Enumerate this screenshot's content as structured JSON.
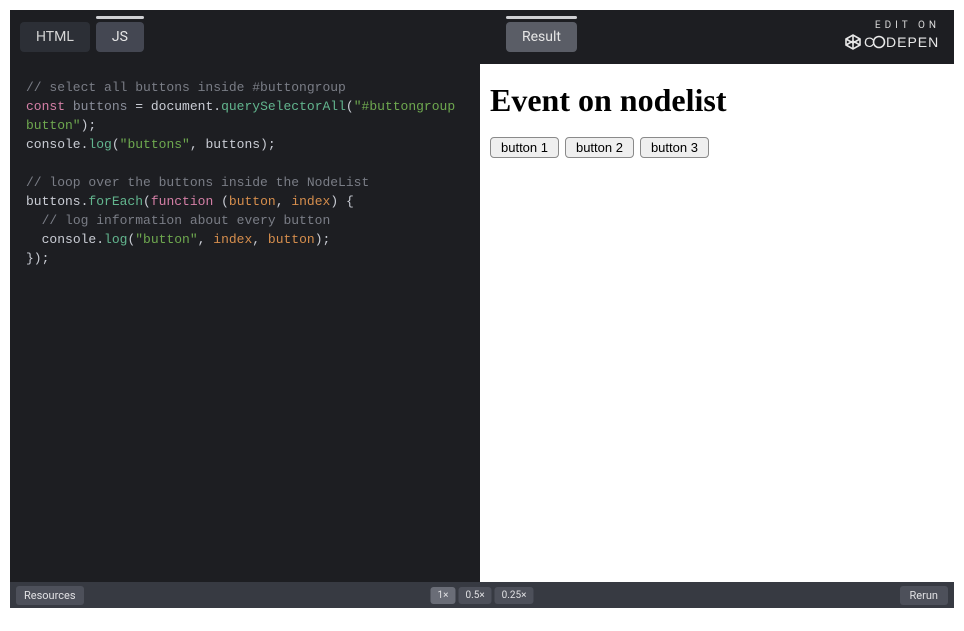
{
  "header": {
    "tab_html": "HTML",
    "tab_js": "JS",
    "tab_result": "Result",
    "edit_on": "EDIT ON",
    "brand": "CODEPEN"
  },
  "code": {
    "l1_comment": "// select all buttons inside #buttongroup",
    "l2_kw": "const",
    "l2_var": "buttons",
    "l2_eq": " = ",
    "l2_doc": "document",
    "l2_dot": ".",
    "l2_qsa": "querySelectorAll",
    "l2_open": "(",
    "l2_str": "\"#buttongroup button\"",
    "l2_close": ");",
    "l3_con": "console",
    "l3_dot": ".",
    "l3_log": "log",
    "l3_open": "(",
    "l3_str": "\"buttons\"",
    "l3_comma": ", ",
    "l3_var": "buttons",
    "l3_close": ");",
    "l5_comment": "// loop over the buttons inside the NodeList",
    "l6_var": "buttons",
    "l6_dot": ".",
    "l6_fe": "forEach",
    "l6_open": "(",
    "l6_fnkw": "function",
    "l6_sp": " ",
    "l6_open2": "(",
    "l6_a1": "button",
    "l6_comma": ", ",
    "l6_a2": "index",
    "l6_close2": ")",
    "l6_brace": " {",
    "l7_comment": "  // log information about every button",
    "l8_pad": "  ",
    "l8_con": "console",
    "l8_dot": ".",
    "l8_log": "log",
    "l8_open": "(",
    "l8_str": "\"button\"",
    "l8_comma1": ", ",
    "l8_idx": "index",
    "l8_comma2": ", ",
    "l8_btn": "button",
    "l8_close": ");",
    "l9": "});"
  },
  "result": {
    "heading": "Event on nodelist",
    "buttons": [
      "button 1",
      "button 2",
      "button 3"
    ]
  },
  "footer": {
    "resources": "Resources",
    "zoom": [
      "1×",
      "0.5×",
      "0.25×"
    ],
    "rerun": "Rerun"
  }
}
